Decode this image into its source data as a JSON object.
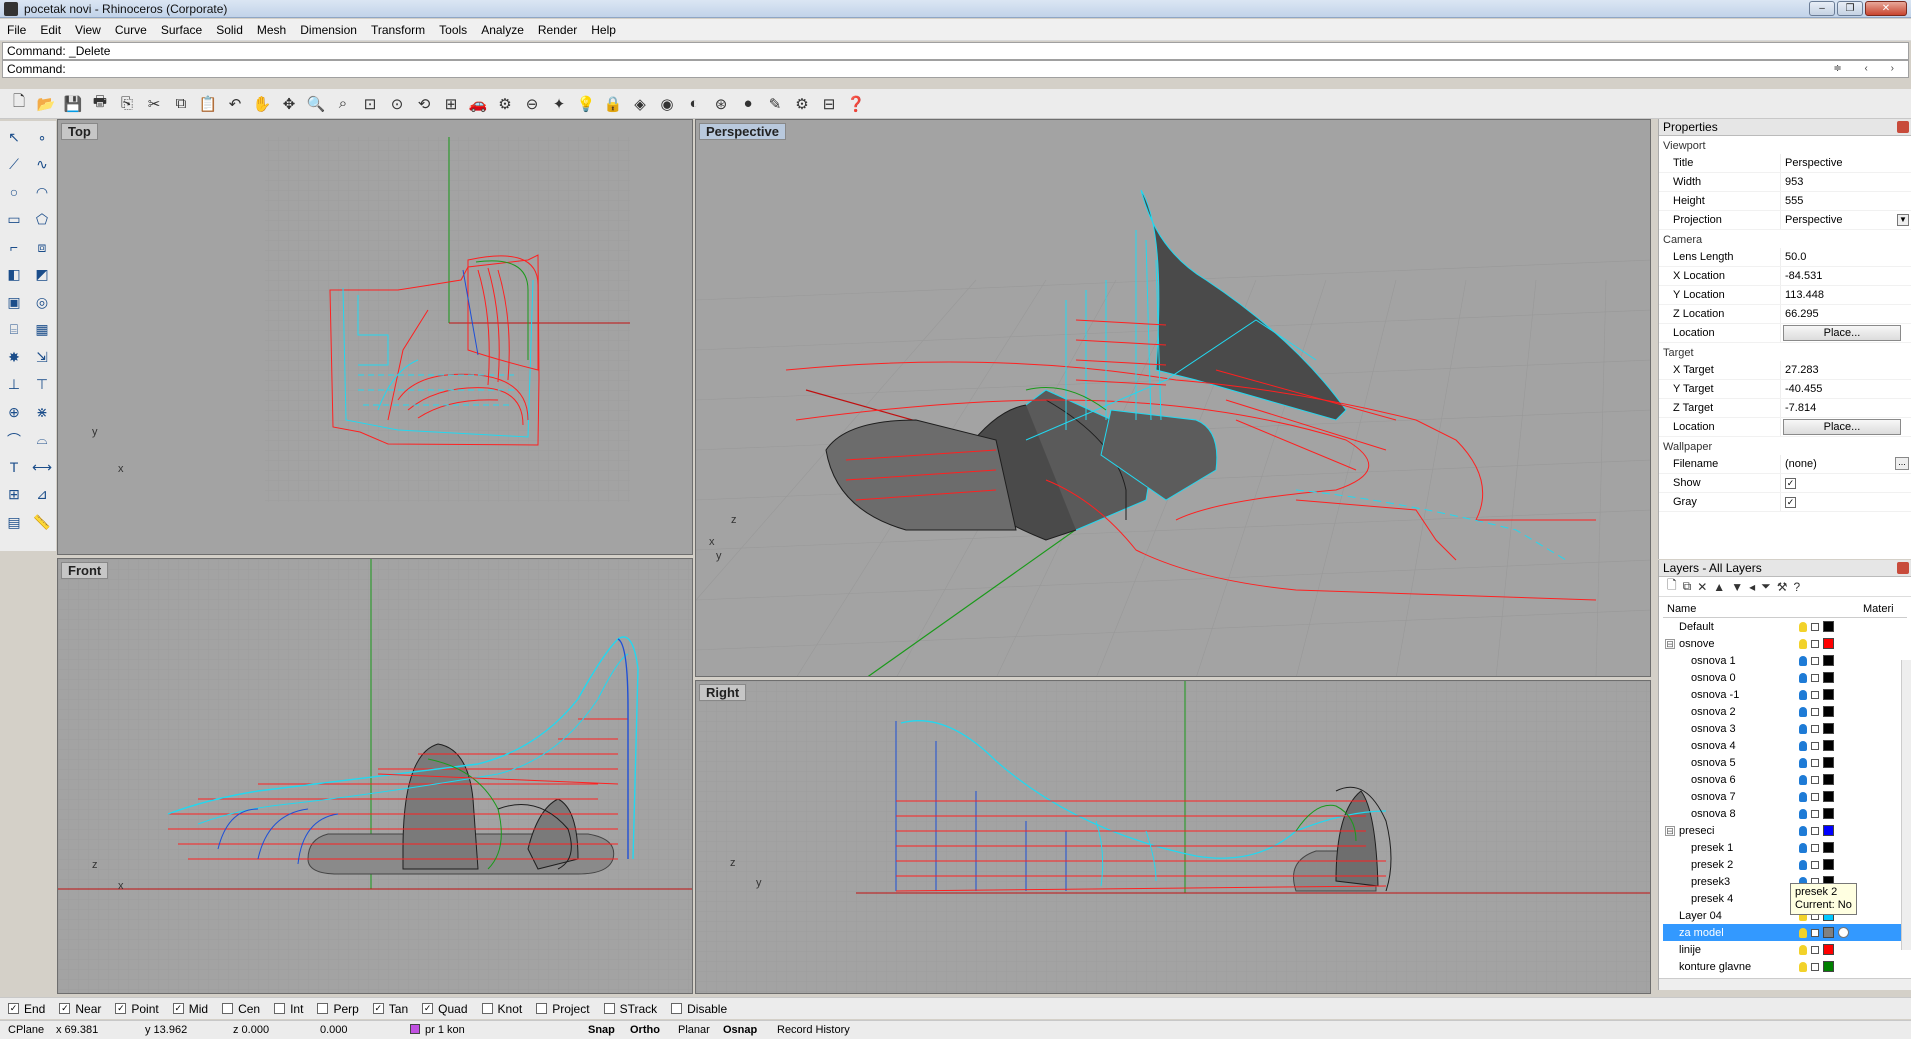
{
  "window": {
    "title": "pocetak novi - Rhinoceros (Corporate)",
    "buttons": [
      "–",
      "❐",
      "✕"
    ]
  },
  "menu": [
    "File",
    "Edit",
    "View",
    "Curve",
    "Surface",
    "Solid",
    "Mesh",
    "Dimension",
    "Transform",
    "Tools",
    "Analyze",
    "Render",
    "Help"
  ],
  "command": {
    "history": "Command: _Delete",
    "prompt": "Command:",
    "arrows": "≑ ‹ ›"
  },
  "viewports": {
    "top": "Top",
    "perspective": "Perspective",
    "front": "Front",
    "right": "Right"
  },
  "axis_labels": {
    "x": "x",
    "y": "y",
    "z": "z"
  },
  "properties": {
    "title": "Properties",
    "viewport_section": "Viewport",
    "rows": [
      {
        "k": "Title",
        "v": "Perspective"
      },
      {
        "k": "Width",
        "v": "953"
      },
      {
        "k": "Height",
        "v": "555"
      },
      {
        "k": "Projection",
        "v": "Perspective"
      }
    ],
    "camera_section": "Camera",
    "camera_rows": [
      {
        "k": "Lens Length",
        "v": "50.0"
      },
      {
        "k": "X Location",
        "v": "-84.531"
      },
      {
        "k": "Y Location",
        "v": "113.448"
      },
      {
        "k": "Z Location",
        "v": "66.295"
      },
      {
        "k": "Location",
        "v": "Place..."
      }
    ],
    "target_section": "Target",
    "target_rows": [
      {
        "k": "X Target",
        "v": "27.283"
      },
      {
        "k": "Y Target",
        "v": "-40.455"
      },
      {
        "k": "Z Target",
        "v": "-7.814"
      },
      {
        "k": "Location",
        "v": "Place..."
      }
    ],
    "wallpaper_section": "Wallpaper",
    "wallpaper_rows": [
      {
        "k": "Filename",
        "v": "(none)"
      },
      {
        "k": "Show",
        "v": "✓"
      },
      {
        "k": "Gray",
        "v": "✓"
      }
    ]
  },
  "layers": {
    "title": "Layers - All Layers",
    "col_name": "Name",
    "col_material": "Materi",
    "rows": [
      {
        "name": "Default",
        "indent": 0,
        "color": "#000000",
        "bulb": "y"
      },
      {
        "name": "osnove",
        "indent": 0,
        "color": "#ff0000",
        "bulb": "y",
        "expander": "⊟"
      },
      {
        "name": "osnova 1",
        "indent": 1,
        "color": "#000000",
        "bulb": "b"
      },
      {
        "name": "osnova 0",
        "indent": 1,
        "color": "#000000",
        "bulb": "b"
      },
      {
        "name": "osnova -1",
        "indent": 1,
        "color": "#000000",
        "bulb": "b"
      },
      {
        "name": "osnova 2",
        "indent": 1,
        "color": "#000000",
        "bulb": "b"
      },
      {
        "name": "osnova 3",
        "indent": 1,
        "color": "#000000",
        "bulb": "b"
      },
      {
        "name": "osnova 4",
        "indent": 1,
        "color": "#000000",
        "bulb": "b"
      },
      {
        "name": "osnova 5",
        "indent": 1,
        "color": "#000000",
        "bulb": "b"
      },
      {
        "name": "osnova 6",
        "indent": 1,
        "color": "#000000",
        "bulb": "b"
      },
      {
        "name": "osnova 7",
        "indent": 1,
        "color": "#000000",
        "bulb": "b"
      },
      {
        "name": "osnova 8",
        "indent": 1,
        "color": "#000000",
        "bulb": "b"
      },
      {
        "name": "preseci",
        "indent": 0,
        "color": "#0000ff",
        "bulb": "b",
        "expander": "⊟"
      },
      {
        "name": "presek 1",
        "indent": 1,
        "color": "#000000",
        "bulb": "b"
      },
      {
        "name": "presek 2",
        "indent": 1,
        "color": "#000000",
        "bulb": "b"
      },
      {
        "name": "presek3",
        "indent": 1,
        "color": "#000000",
        "bulb": "b"
      },
      {
        "name": "presek 4",
        "indent": 1,
        "color": "#000000",
        "bulb": "b"
      },
      {
        "name": "Layer 04",
        "indent": 0,
        "color": "#00c8ff",
        "bulb": "y"
      },
      {
        "name": "za model",
        "indent": 0,
        "color": "#808080",
        "bulb": "y",
        "selected": true
      },
      {
        "name": "linije",
        "indent": 0,
        "color": "#ff0000",
        "bulb": "y"
      },
      {
        "name": "konture glavne",
        "indent": 0,
        "color": "#008000",
        "bulb": "y"
      }
    ],
    "tooltip_line1": "presek 2",
    "tooltip_line2": "Current: No"
  },
  "osnaps": [
    {
      "label": "End",
      "checked": true
    },
    {
      "label": "Near",
      "checked": true
    },
    {
      "label": "Point",
      "checked": true
    },
    {
      "label": "Mid",
      "checked": true
    },
    {
      "label": "Cen",
      "checked": false
    },
    {
      "label": "Int",
      "checked": false
    },
    {
      "label": "Perp",
      "checked": false
    },
    {
      "label": "Tan",
      "checked": true
    },
    {
      "label": "Quad",
      "checked": true
    },
    {
      "label": "Knot",
      "checked": false
    },
    {
      "label": "Project",
      "checked": false
    },
    {
      "label": "STrack",
      "checked": false
    },
    {
      "label": "Disable",
      "checked": false
    }
  ],
  "status": {
    "cplane": "CPlane",
    "x": "x 69.381",
    "y": "y 13.962",
    "z": "z 0.000",
    "d": "0.000",
    "layer": "pr 1 kon",
    "snap": "Snap",
    "ortho": "Ortho",
    "planar": "Planar",
    "osnap": "Osnap",
    "record": "Record History"
  },
  "colors": {
    "viewport_bg": "#a3a3a3",
    "grid": "#999999",
    "curve_red": "#ff2020",
    "curve_cyan": "#22d8f0",
    "axis_green": "#1a9a1a",
    "axis_red": "#c01010",
    "selection": "#3399ff"
  }
}
